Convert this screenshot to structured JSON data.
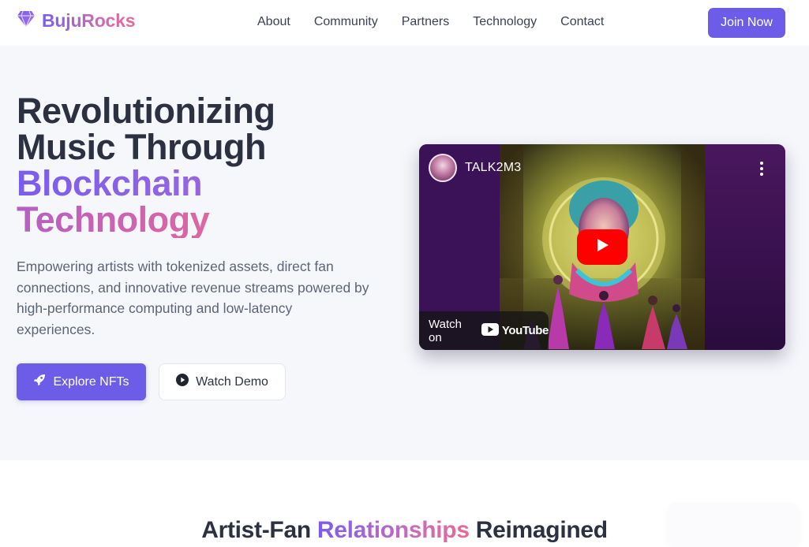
{
  "nav": {
    "brand": "BujuRocks",
    "links": [
      "About",
      "Community",
      "Partners",
      "Technology",
      "Contact"
    ],
    "join_label": "Join Now"
  },
  "hero": {
    "title_line1": "Revolutionizing",
    "title_line2": "Music Through",
    "title_line3": "Blockchain",
    "title_line4": "Technology",
    "description": "Empowering artists with tokenized assets, direct fan connections, and innovative revenue streams powered by high-performance computing and low-latency experiences.",
    "primary_button": "Explore NFTs",
    "secondary_button": "Watch Demo"
  },
  "video": {
    "channel_name": "TALK2M3",
    "watch_on_label": "Watch on",
    "platform_name": "YouTube"
  },
  "section2": {
    "title_part1": "Artist-Fan ",
    "title_part2": "Relationships",
    "title_part3": " Reimagined"
  },
  "colors": {
    "accent": "#6c5ce7",
    "gradient_start": "#7b5cf0",
    "gradient_end": "#e86a96",
    "heading": "#2b3140",
    "hero_bg": "#f5f7fb"
  },
  "icons": {
    "brand": "gem-icon",
    "primary_button": "rocket-icon",
    "secondary_button": "play-circle-icon",
    "video_menu": "kebab-menu-icon",
    "video_play": "youtube-play-icon"
  }
}
